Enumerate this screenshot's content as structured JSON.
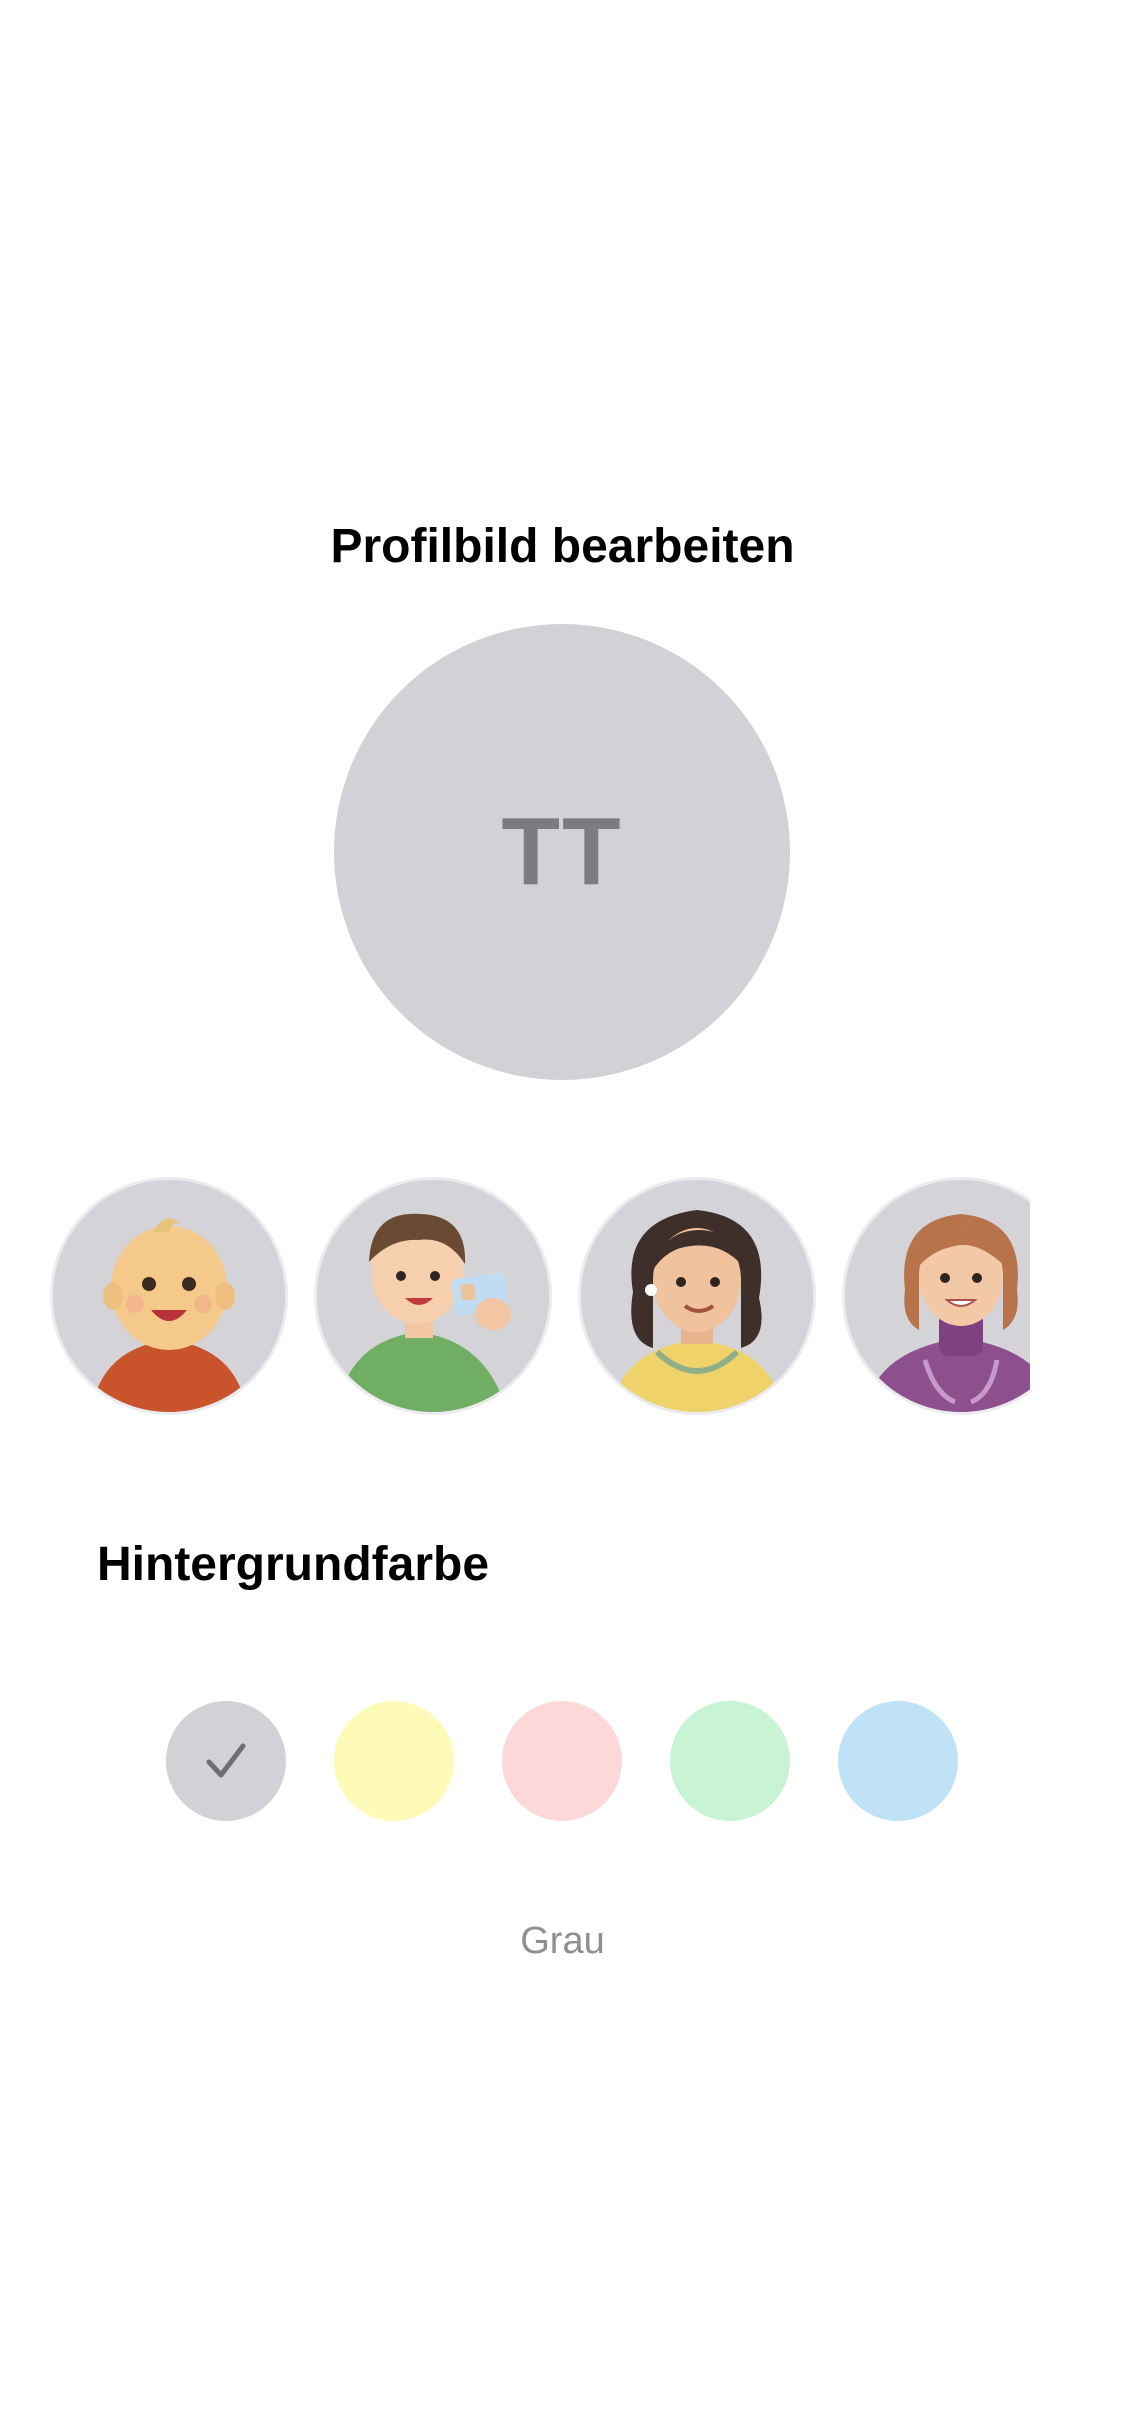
{
  "header": {
    "title": "Profilbild bearbeiten"
  },
  "profile": {
    "initials": "TT",
    "background_color": "#d1d1d6"
  },
  "avatar_options": [
    {
      "icon": "baby-avatar-icon",
      "shirt_color": "#c9542c"
    },
    {
      "icon": "boy-with-id-card-avatar-icon",
      "shirt_color": "#6fae63"
    },
    {
      "icon": "woman-with-curly-hair-avatar-icon",
      "shirt_color": "#efd36a"
    },
    {
      "icon": "doctor-with-stethoscope-avatar-icon",
      "shirt_color": "#8e4f8e"
    }
  ],
  "background_section": {
    "heading": "Hintergrundfarbe",
    "selected_index": 0,
    "selected_label": "Grau",
    "swatches": [
      {
        "color": "#d1d1d6",
        "selected": true
      },
      {
        "color": "#fefbb8",
        "selected": false
      },
      {
        "color": "#fdd8d8",
        "selected": false
      },
      {
        "color": "#c8f4d4",
        "selected": false
      },
      {
        "color": "#bfe2f6",
        "selected": false
      }
    ]
  }
}
